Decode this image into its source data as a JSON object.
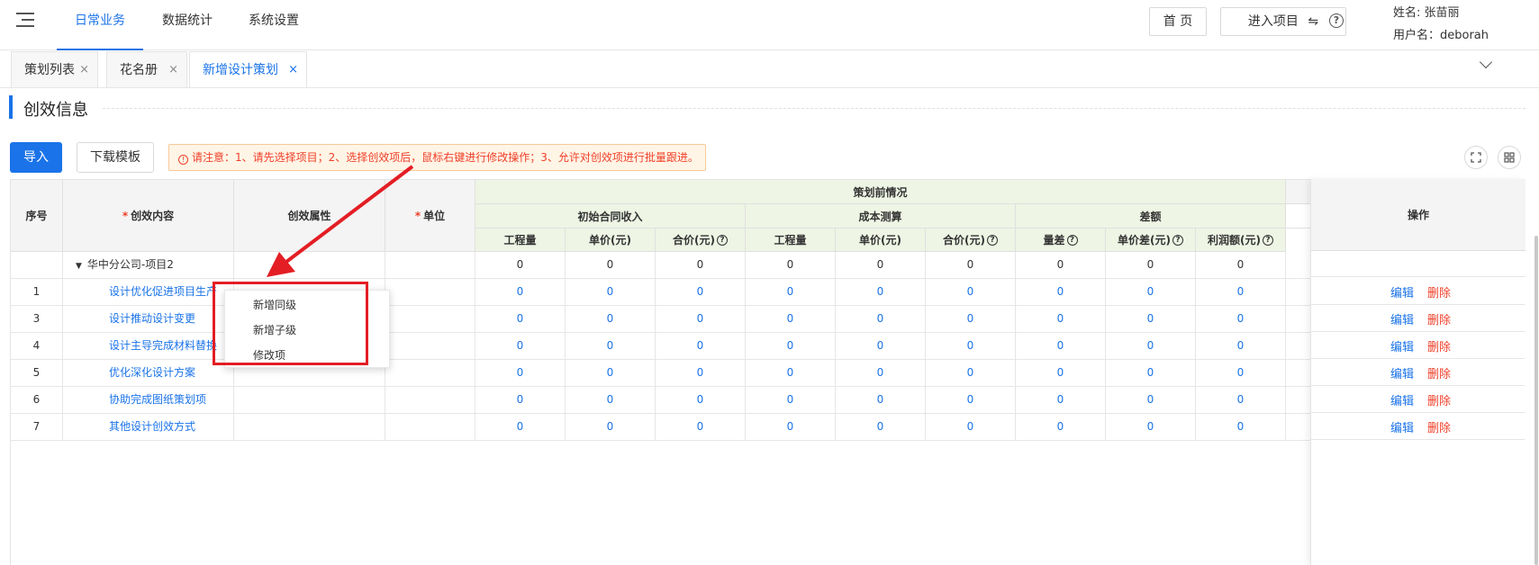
{
  "header": {
    "nav": [
      "日常业务",
      "数据统计",
      "系统设置"
    ],
    "home_label": "首 页",
    "enter_project_label": "进入项目",
    "help_symbol": "?",
    "user_name_line": "姓名: 张苗丽",
    "user_account_line": "用户名：deborah"
  },
  "tabs": [
    {
      "label": "策划列表"
    },
    {
      "label": "花名册"
    },
    {
      "label": "新增设计策划"
    }
  ],
  "tab_close_symbol": "×",
  "section": {
    "title": "创效信息"
  },
  "toolbar": {
    "import_label": "导入",
    "download_label": "下载模板",
    "notice": "请注意：1、请先选择项目；2、选择创效项后，鼠标右键进行修改操作；3、允许对创效项进行批量跟进。",
    "notice_icon": "!"
  },
  "table": {
    "h_seq": "序号",
    "h_content": "创效内容",
    "h_attr": "创效属性",
    "h_unit": "单位",
    "h_pre": "策划前情况",
    "h_group1": "初始合同收入",
    "h_group2": "成本测算",
    "h_group3": "差额",
    "h_ops": "操作",
    "sub": [
      "工程量",
      "单价(元)",
      "合价(元)",
      "工程量",
      "单价(元)",
      "合价(元)",
      "量差",
      "单价差(元)",
      "利润额(元)"
    ],
    "q_symbol": "?",
    "parent": {
      "label": "华中分公司-项目2",
      "values": [
        "0",
        "0",
        "0",
        "0",
        "0",
        "0",
        "0",
        "0",
        "0"
      ]
    },
    "rows": [
      {
        "seq": "1",
        "content": "设计优化促进项目生产",
        "values": [
          "0",
          "0",
          "0",
          "0",
          "0",
          "0",
          "0",
          "0",
          "0"
        ]
      },
      {
        "seq": "3",
        "content": "设计推动设计变更",
        "values": [
          "0",
          "0",
          "0",
          "0",
          "0",
          "0",
          "0",
          "0",
          "0"
        ]
      },
      {
        "seq": "4",
        "content": "设计主导完成材料替换",
        "values": [
          "0",
          "0",
          "0",
          "0",
          "0",
          "0",
          "0",
          "0",
          "0"
        ]
      },
      {
        "seq": "5",
        "content": "优化深化设计方案",
        "values": [
          "0",
          "0",
          "0",
          "0",
          "0",
          "0",
          "0",
          "0",
          "0"
        ]
      },
      {
        "seq": "6",
        "content": "协助完成图纸策划项",
        "values": [
          "0",
          "0",
          "0",
          "0",
          "0",
          "0",
          "0",
          "0",
          "0"
        ]
      },
      {
        "seq": "7",
        "content": "其他设计创效方式",
        "values": [
          "0",
          "0",
          "0",
          "0",
          "0",
          "0",
          "0",
          "0",
          "0"
        ]
      }
    ],
    "edit_label": "编辑",
    "delete_label": "删除"
  },
  "context_menu": {
    "items": [
      "新增同级",
      "新增子级",
      "修改项"
    ]
  },
  "colors": {
    "accent": "#1a73e8",
    "danger": "#f0402a",
    "annotation": "#e31e24"
  }
}
